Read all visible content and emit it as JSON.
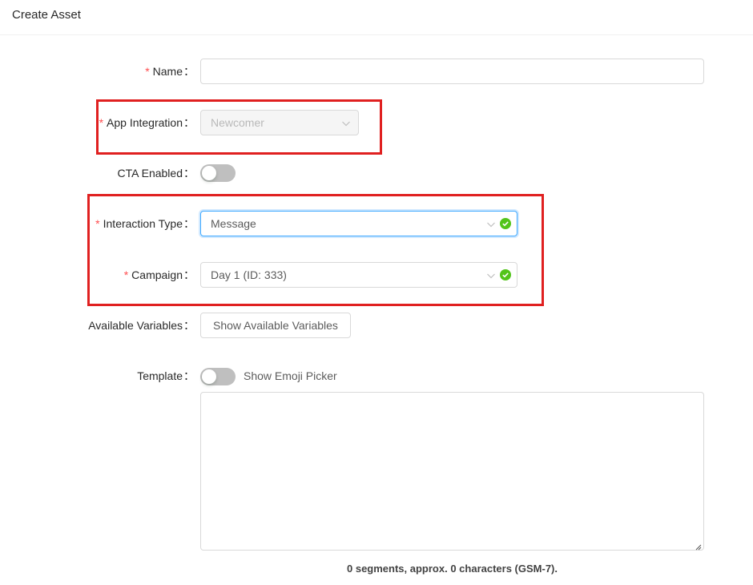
{
  "header": {
    "title": "Create Asset"
  },
  "form": {
    "name": {
      "label": "Name",
      "required": "*",
      "value": ""
    },
    "app_integration": {
      "label": "App Integration",
      "required": "*",
      "value": "Newcomer"
    },
    "cta_enabled": {
      "label": "CTA Enabled",
      "enabled": false
    },
    "interaction_type": {
      "label": "Interaction Type",
      "required": "*",
      "value": "Message"
    },
    "campaign": {
      "label": "Campaign",
      "required": "*",
      "value": "Day 1 (ID: 333)"
    },
    "available_variables": {
      "label": "Available Variables",
      "button_label": "Show Available Variables"
    },
    "template": {
      "label": "Template",
      "emoji_toggle_label": "Show Emoji Picker",
      "emoji_enabled": false,
      "value": ""
    },
    "colon": "：",
    "segment_info": "0 segments, approx. 0 characters (GSM-7)."
  },
  "colors": {
    "required": "#ff4d4f",
    "success": "#52c41a",
    "focus_border": "#40a9ff",
    "highlight_box": "#e02020"
  },
  "icons": {
    "dropdown": "chevron-down-icon",
    "valid": "check-circle-icon",
    "resize": "resize-grip-icon"
  }
}
